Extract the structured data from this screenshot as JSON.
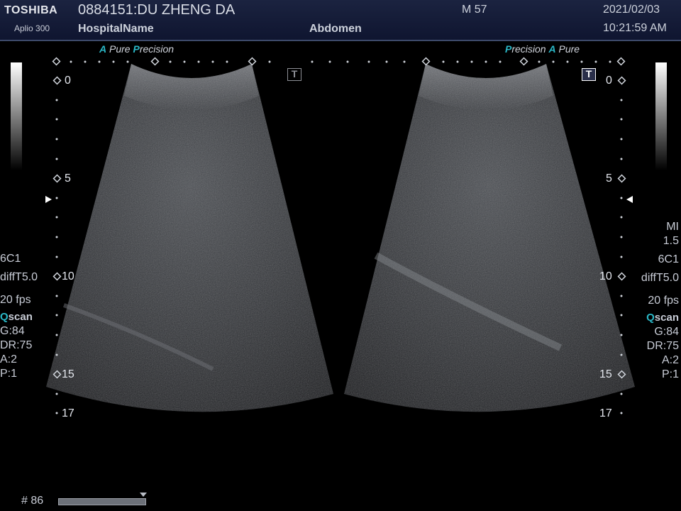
{
  "header": {
    "brand": "TOSHIBA",
    "model": "Aplio 300",
    "patient": "0884151:DU ZHENG DA",
    "hospital": "HospitalName",
    "exam": "Abdomen",
    "sex_age": "M 57",
    "date": "2021/02/03",
    "time": "10:21:59 AM"
  },
  "left_image": {
    "tag_a": "A",
    "tag_pure": "Pure",
    "tag_p": "P",
    "tag_precision": "recision",
    "depth_labels": [
      "0",
      "5",
      "10",
      "15",
      "17"
    ]
  },
  "right_image": {
    "tag_p": "P",
    "tag_precision": "recision",
    "tag_a": "A",
    "tag_pure": "Pure",
    "depth_labels": [
      "0",
      "5",
      "10",
      "15",
      "17"
    ]
  },
  "left_params": {
    "probe": "6C1",
    "mode": "diffT5.0",
    "fps": "20 fps",
    "q": "Q",
    "scan": "scan",
    "gain": "G:84",
    "dr": "DR:75",
    "a": "A:2",
    "p": "P:1"
  },
  "right_params": {
    "mi_label": "MI",
    "mi_value": "1.5",
    "probe": "6C1",
    "mode": "diffT5.0",
    "fps": "20 fps",
    "q": "Q",
    "scan": "scan",
    "gain": "G:84",
    "dr": "DR:75",
    "a": "A:2",
    "p": "P:1"
  },
  "footer": {
    "frame": "# 86"
  },
  "colors": {
    "header_bg": "#161d38",
    "accent_teal": "#2ab7c6",
    "text": "#d0d4dc"
  },
  "icons": {
    "left_t": "T",
    "right_t": "T"
  }
}
